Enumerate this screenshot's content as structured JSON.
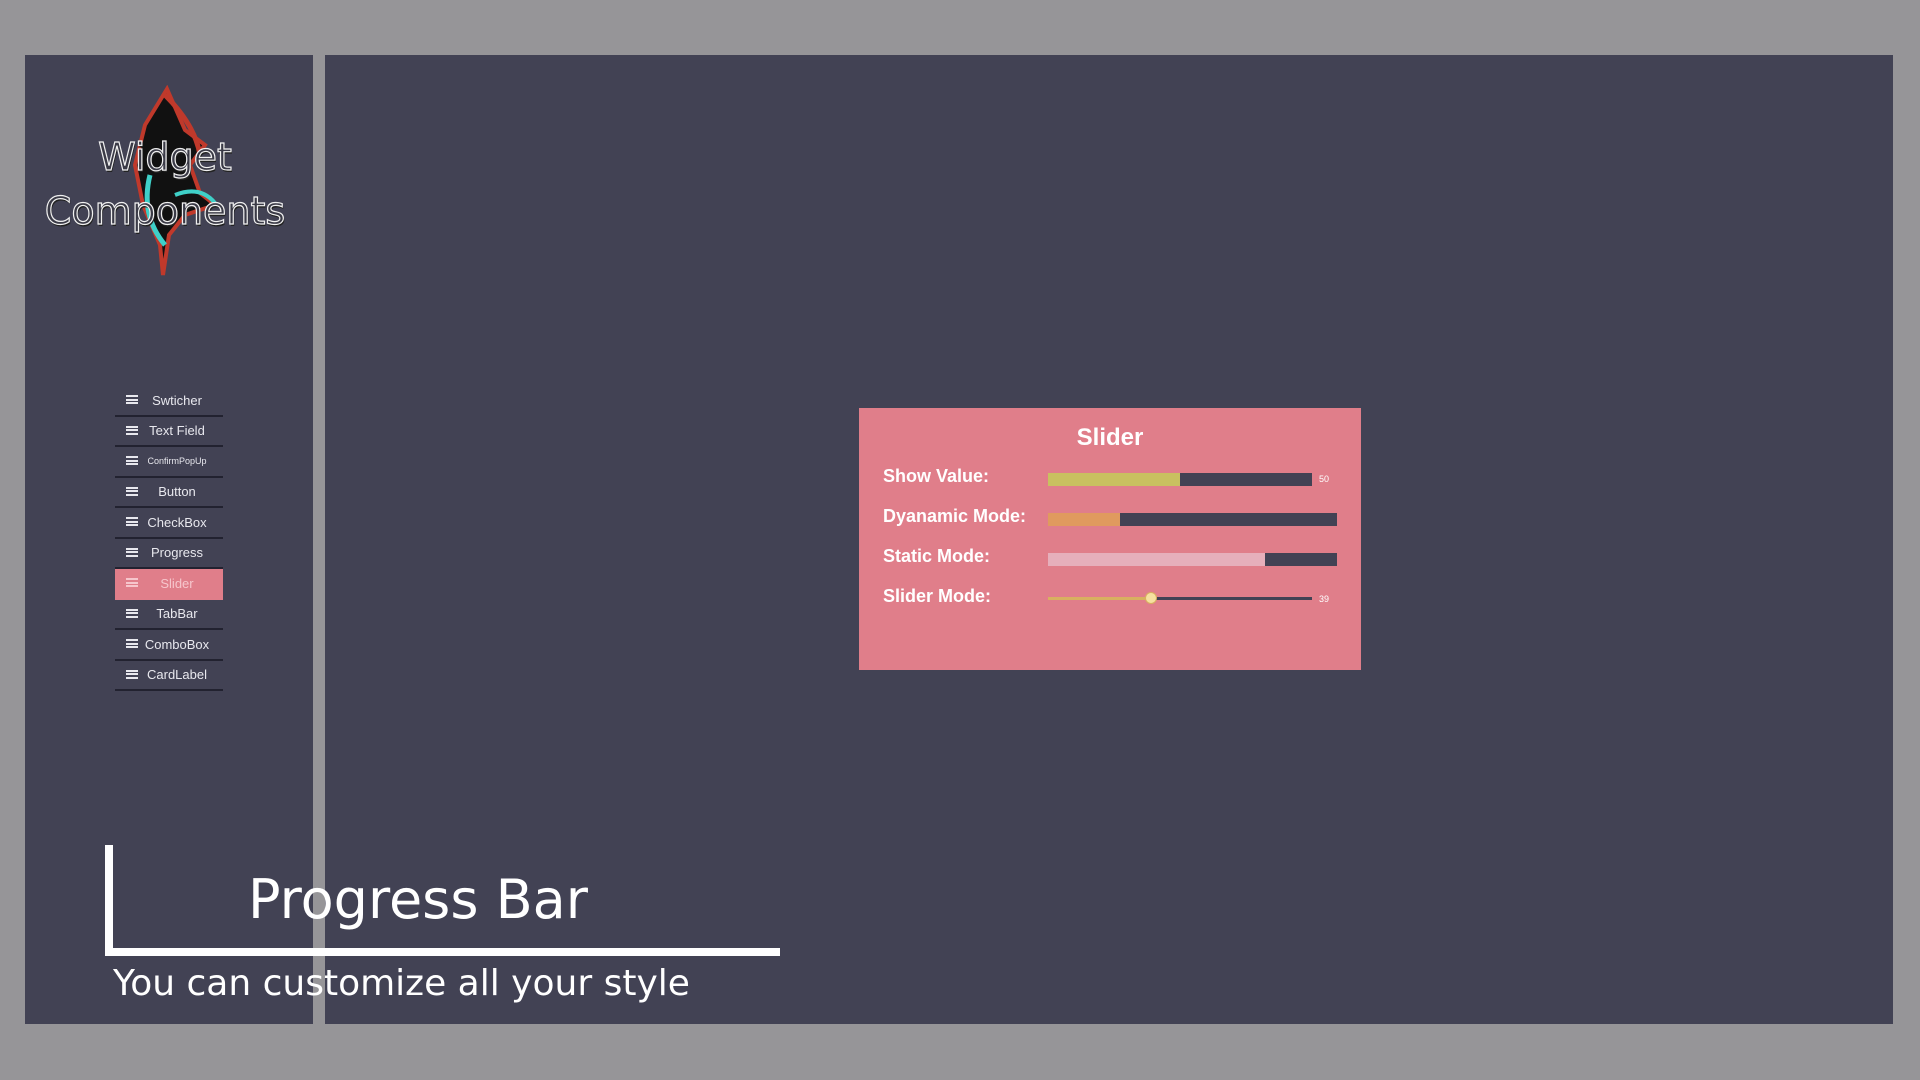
{
  "logo": {
    "line1": "Widget",
    "line2": "Components"
  },
  "nav": {
    "items": [
      {
        "label": "Swticher",
        "active": false
      },
      {
        "label": "Text Field",
        "active": false
      },
      {
        "label": "ConfirmPopUp",
        "active": false
      },
      {
        "label": "Button",
        "active": false
      },
      {
        "label": "CheckBox",
        "active": false
      },
      {
        "label": "Progress",
        "active": false
      },
      {
        "label": "Slider",
        "active": true
      },
      {
        "label": "TabBar",
        "active": false
      },
      {
        "label": "ComboBox",
        "active": false
      },
      {
        "label": "CardLabel",
        "active": false
      }
    ]
  },
  "card": {
    "title": "Slider",
    "rows": [
      {
        "label": "Show Value:",
        "value_text": "50",
        "fill_fraction": 0.5,
        "fill_color": "#c9c060"
      },
      {
        "label": "Dyanamic Mode:",
        "fill_fraction": 0.25,
        "fill_color": "#e09a5e"
      },
      {
        "label": "Static Mode:",
        "fill_fraction": 0.75,
        "fill_color": "#e6afbb"
      },
      {
        "label": "Slider Mode:",
        "value_text": "39",
        "fill_fraction": 0.39,
        "fill_color": "#d8b060"
      }
    ]
  },
  "caption": {
    "title": "Progress Bar",
    "subtitle": "You can customize all your style"
  },
  "colors": {
    "background": "#969598",
    "panel": "#424254",
    "accent": "#e07e8a",
    "track": "#424254"
  }
}
